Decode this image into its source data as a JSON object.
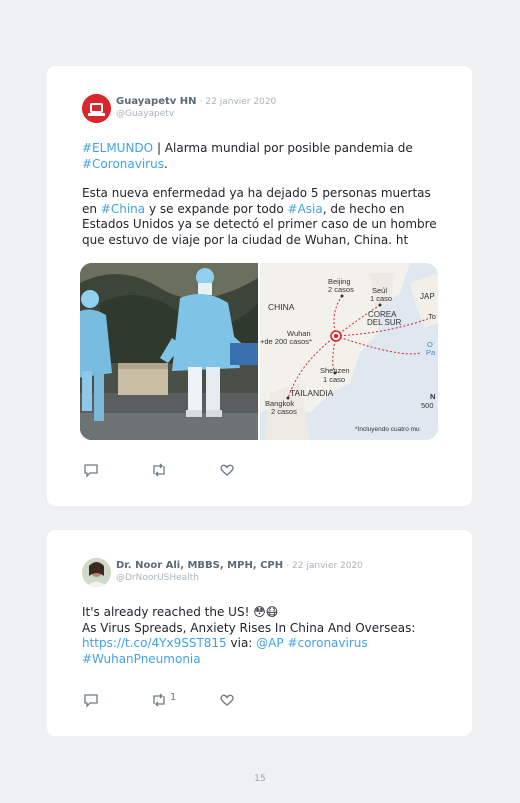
{
  "tweets": [
    {
      "author": "Guayapetv HN",
      "date": "· 22 janvier 2020",
      "handle": "@Guayapetv",
      "lines": {
        "l1_tag": "#ELMUNDO",
        "l1_text": " | Alarma mundial por posible pandemia de",
        "l2_tag": "#Coronavirus",
        "l2_text": ".",
        "l3": "Esta nueva enfermedad ya ha dejado 5 personas muertas",
        "l4_a": "en ",
        "l4_tag1": "#China",
        "l4_b": " y se expande por todo ",
        "l4_tag2": "#Asia",
        "l4_c": ", de hecho en",
        "l5": "Estados Unidos ya se detectó el primer caso de un hombre",
        "l6": "que estuvo de viaje por la ciudad de Wuhan, China. ht"
      },
      "map_labels": {
        "china": "CHINA",
        "beijing": "Beijing",
        "beijing_cases": "2 casos",
        "seoul": "Seúl",
        "seoul_cases": "1 caso",
        "corea": "COREA",
        "corea2": "DEL SUR",
        "jap": "JAP",
        "to": "To",
        "wuhan": "Wuhan",
        "wuhan_cases": "+de 200 casos*",
        "shenzen": "Shenzen",
        "shenzen_cases": "1 caso",
        "tailandia": "TAILANDIA",
        "bangkok": "Bangkok",
        "bangkok_cases": "2 casos",
        "note": "*Incluyendo cuatro mu",
        "scale_n": "N",
        "scale_val": "500",
        "blue1": "O",
        "blue2": "Pa"
      },
      "retweets": "",
      "colors": {
        "avatar_bg": "#d8262c"
      }
    },
    {
      "author": "Dr. Noor Ali, MBBS, MPH, CPH",
      "date": "· 22 janvier 2020",
      "handle": "@DrNoorUSHealth",
      "lines": {
        "l1": "It's already reached the US! 😳😷",
        "l2": "As Virus Spreads, Anxiety Rises In China And Overseas:",
        "l3_link": "https://t.co/4Yx9SST815",
        "l3_via": " via: ",
        "l3_at": "@AP",
        "l3_sp": " ",
        "l3_tag": "#coronavirus",
        "l4_tag": "#WuhanPneumonia"
      },
      "retweets": "1"
    }
  ],
  "page_number": "15",
  "icons": [
    "reply-icon",
    "retweet-icon",
    "like-icon"
  ]
}
